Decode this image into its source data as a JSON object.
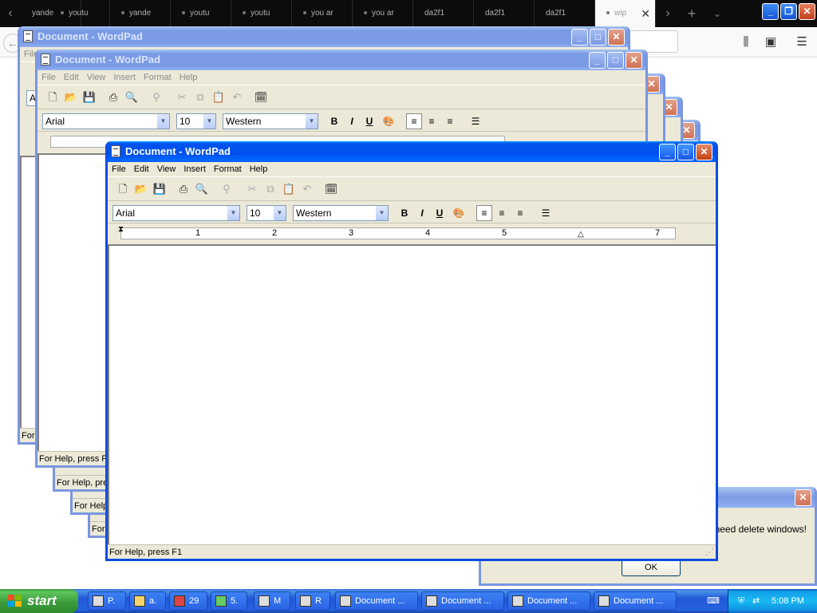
{
  "browser": {
    "tabs": [
      {
        "label": "yande"
      },
      {
        "label": "youtu"
      },
      {
        "label": "yande"
      },
      {
        "label": "youtu"
      },
      {
        "label": "youtu"
      },
      {
        "label": "you ar"
      },
      {
        "label": "you ar"
      },
      {
        "label": "da2f1"
      },
      {
        "label": "da2f1"
      },
      {
        "label": "da2f1"
      },
      {
        "label": "wip"
      }
    ]
  },
  "window": {
    "title": "Document - WordPad",
    "menu": [
      "File",
      "Edit",
      "View",
      "Insert",
      "Format",
      "Help"
    ],
    "font": "Arial",
    "size": "10",
    "script": "Western",
    "status": "For Help, press F1",
    "status_partial": "For Help, pre",
    "ruler_numbers": [
      "1",
      "2",
      "3",
      "4",
      "5",
      "7"
    ]
  },
  "partial": {
    "font_stub": "Ari",
    "file_stub": "File",
    "status_stub": "For",
    "status_stub2": "For Help, press F"
  },
  "msgbox": {
    "text": "u need delete windows!",
    "ok_label": "OK"
  },
  "taskbar": {
    "start_label": "start",
    "buttons": [
      {
        "label": "P."
      },
      {
        "label": "a."
      },
      {
        "label": "29"
      },
      {
        "label": "5."
      },
      {
        "label": "M"
      },
      {
        "label": "R"
      },
      {
        "label": "Document ..."
      },
      {
        "label": "Document ..."
      },
      {
        "label": "Document ..."
      },
      {
        "label": "Document ..."
      }
    ],
    "clock": "5:08 PM"
  }
}
